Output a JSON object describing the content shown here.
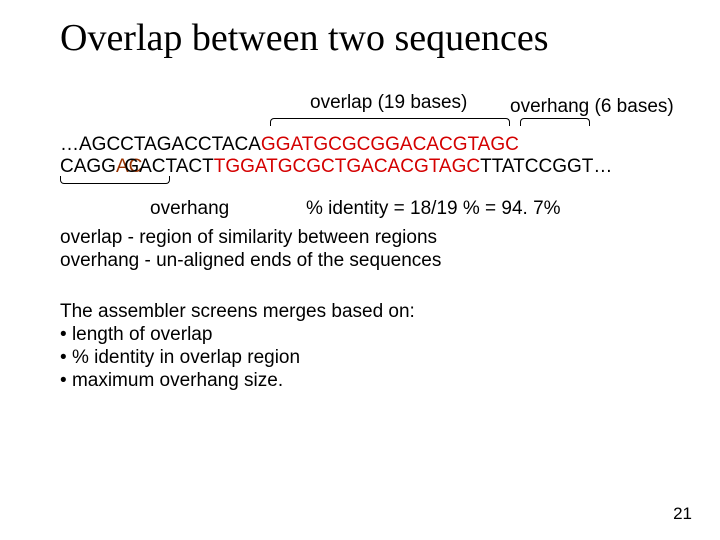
{
  "title": "Overlap between two sequences",
  "labels": {
    "overlap_top": "overlap (19 bases)",
    "overhang_top": "overhang (6 bases)",
    "overhang_bottom": "overhang",
    "identity": "% identity = 18/19 % = 94. 7%"
  },
  "sequences": {
    "seq1_pre": "…AGCCTAGACCTACA",
    "seq1_ov": "GGATGCGCGGACACGTAGC",
    "seq2_pre_left": "CAGG",
    "seq2_pre_merge": "AC",
    "seq2_pre_right": "GACTACT",
    "seq2_ov": "TGGATGCGCTGACACGTAGC",
    "seq2_post": "TTATCCGGT…"
  },
  "definitions": {
    "d1_term": "overlap",
    "d1_body": " - region of similarity between regions",
    "d2_term": "overhang",
    "d2_body": " - un-aligned ends of the sequences"
  },
  "criteria": {
    "intro": "The assembler screens merges based on:",
    "b1": "length of overlap",
    "b2": "% identity in overlap region",
    "b3": "maximum overhang size."
  },
  "page": "21"
}
